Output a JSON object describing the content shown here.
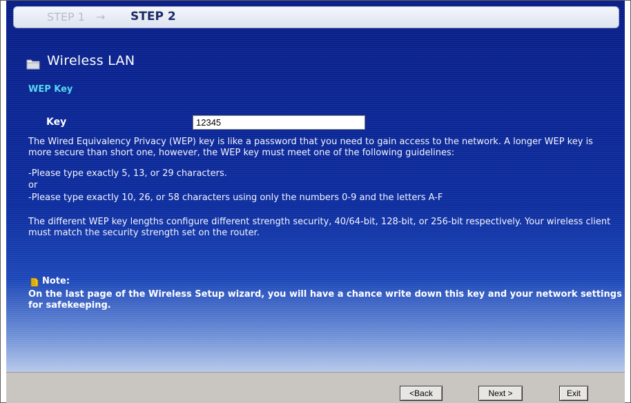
{
  "steps": {
    "step1": "STEP 1",
    "arrow": "→",
    "step2": "STEP 2"
  },
  "title": "Wireless LAN",
  "title_icon": "folder-icon",
  "section": "WEP Key",
  "key": {
    "label": "Key",
    "value": "12345"
  },
  "description": {
    "p1": "The Wired Equivalency Privacy (WEP) key is like a password that you need to gain access to the network. A longer WEP key is more secure than short one, however, the WEP key must meet one of the following guidelines:",
    "rule1": "-Please type exactly 5, 13, or 29 characters.",
    "or": "or",
    "rule2": "-Please type exactly 10, 26, or 58 characters using only the numbers 0-9 and the letters A-F",
    "p2": "The different WEP key lengths configure different strength security, 40/64-bit, 128-bit, or 256-bit respectively. Your wireless client must match the security strength set on the router."
  },
  "note": {
    "icon": "note-icon",
    "label": "Note:",
    "text": "On the last page of the Wireless Setup wizard, you will have a chance write down this key and your network settings for safekeeping."
  },
  "buttons": {
    "back": "<Back",
    "next": "Next >",
    "exit": "Exit"
  },
  "colors": {
    "panel": "#0b2a95",
    "section_heading": "#56d8f0",
    "footer": "#c9c6c1"
  }
}
